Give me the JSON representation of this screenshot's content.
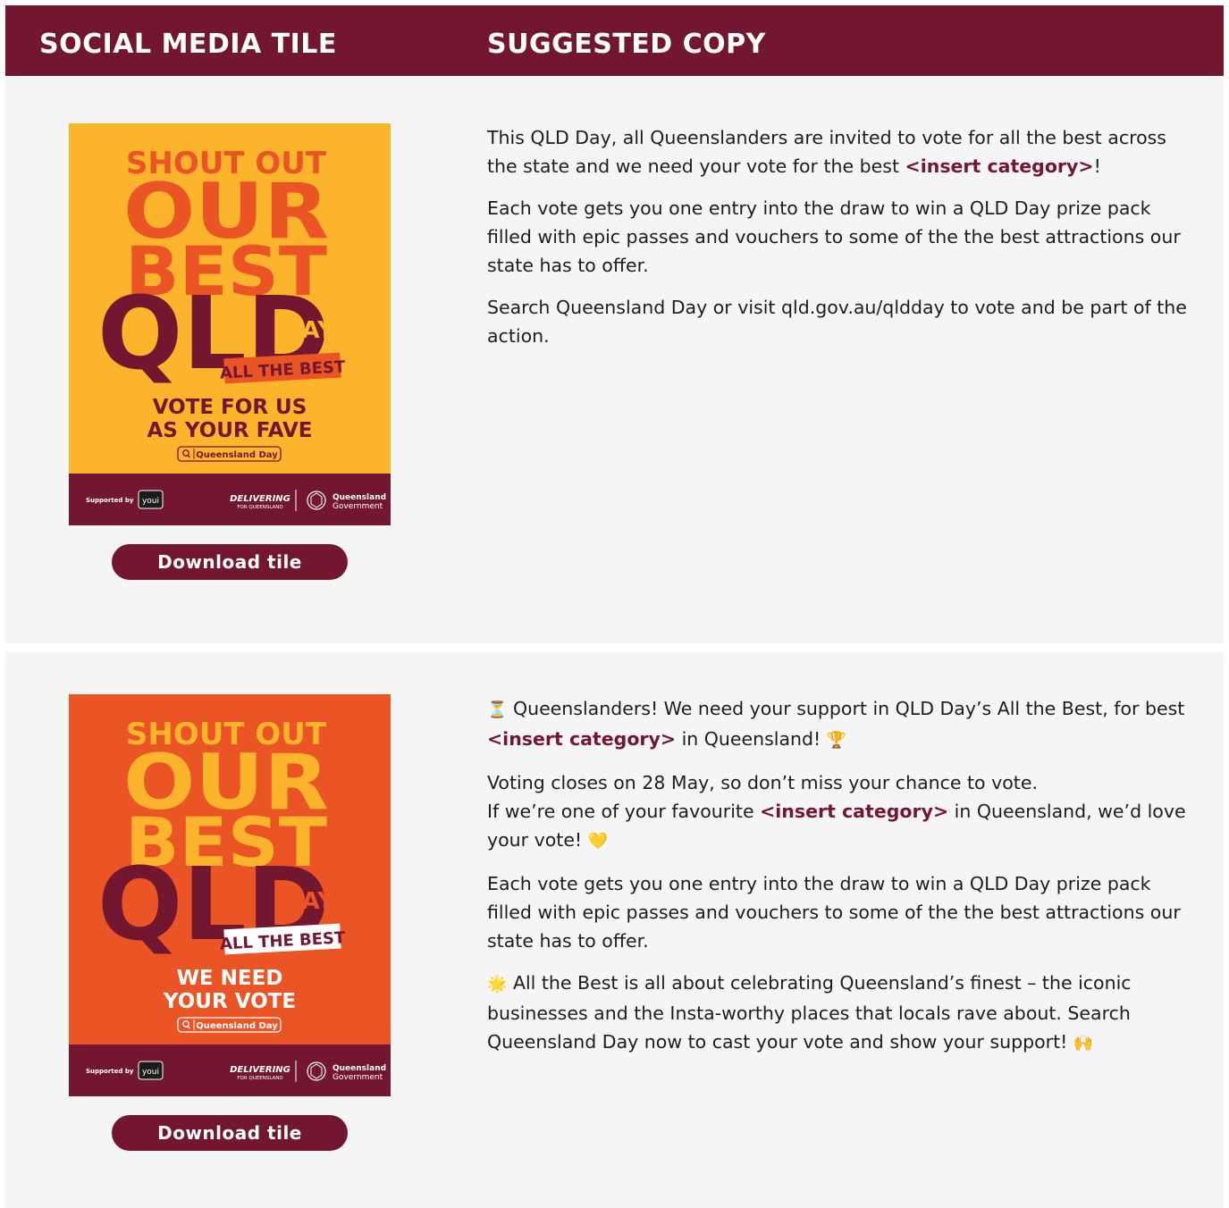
{
  "header": {
    "col1": "SOCIAL MEDIA TILE",
    "col2": "SUGGESTED COPY"
  },
  "colors": {
    "maroon": "#731730",
    "tile1_bg": "#FBB42B",
    "tile1_accent": "#EB5424",
    "tile2_bg": "#EB5424",
    "tile2_accent": "#FBB42B",
    "panel_bg": "#F5F5F5"
  },
  "tile_common": {
    "shout_out": "SHOUT OUT",
    "our": "OUR",
    "best": "BEST",
    "qld": "QLD",
    "day": "DAY",
    "all_the_best": "ALL THE BEST",
    "search_label": "Queensland Day",
    "supported_by": "Supported by",
    "youi": "youi",
    "delivering": "DELIVERING",
    "for_queensland": "FOR QUEENSLAND",
    "qld_gov_1": "Queensland",
    "qld_gov_2": "Government"
  },
  "rows": [
    {
      "tile": {
        "line1": "VOTE FOR US",
        "line2": "AS YOUR FAVE"
      },
      "button_label": "Download tile",
      "copy": {
        "p1_a": "This QLD Day, all Queenslanders are invited to vote for all the best across the state and we need your vote for the best ",
        "p1_cat": "<insert category>",
        "p1_b": "!",
        "p2": "Each vote gets you one entry into the draw to win a QLD Day prize pack filled with epic passes and vouchers to some of the the best attractions our state has to offer.",
        "p3": "Search Queensland Day or visit qld.gov.au/qldday to vote and be part of the action."
      }
    },
    {
      "tile": {
        "line1": "WE NEED",
        "line2": "YOUR VOTE"
      },
      "button_label": "Download tile",
      "copy": {
        "p1_emoji": "⏳",
        "p1_a": " Queenslanders! We need your support in QLD Day’s All the Best, for best ",
        "p1_cat": "<insert category>",
        "p1_b": " in Queensland! ",
        "p1_emoji2": "🏆",
        "p2_a": "Voting closes on 28 May, so don’t miss your chance to vote.",
        "p2_b": "If we’re one of your favourite ",
        "p2_cat": "<insert category>",
        "p2_c": " in Queensland, we’d love your vote! ",
        "p2_emoji": "💛",
        "p3": "Each vote gets you one entry into the draw to win a QLD Day prize pack filled with epic passes and vouchers to some of the the best attractions our state has to offer.",
        "p4_emoji": "🌟",
        "p4_a": " All the Best is all about celebrating Queensland’s finest – the iconic businesses and the Insta-worthy places that locals rave about. Search Queensland Day now to cast your vote and show your support! ",
        "p4_emoji2": "🙌"
      }
    }
  ]
}
